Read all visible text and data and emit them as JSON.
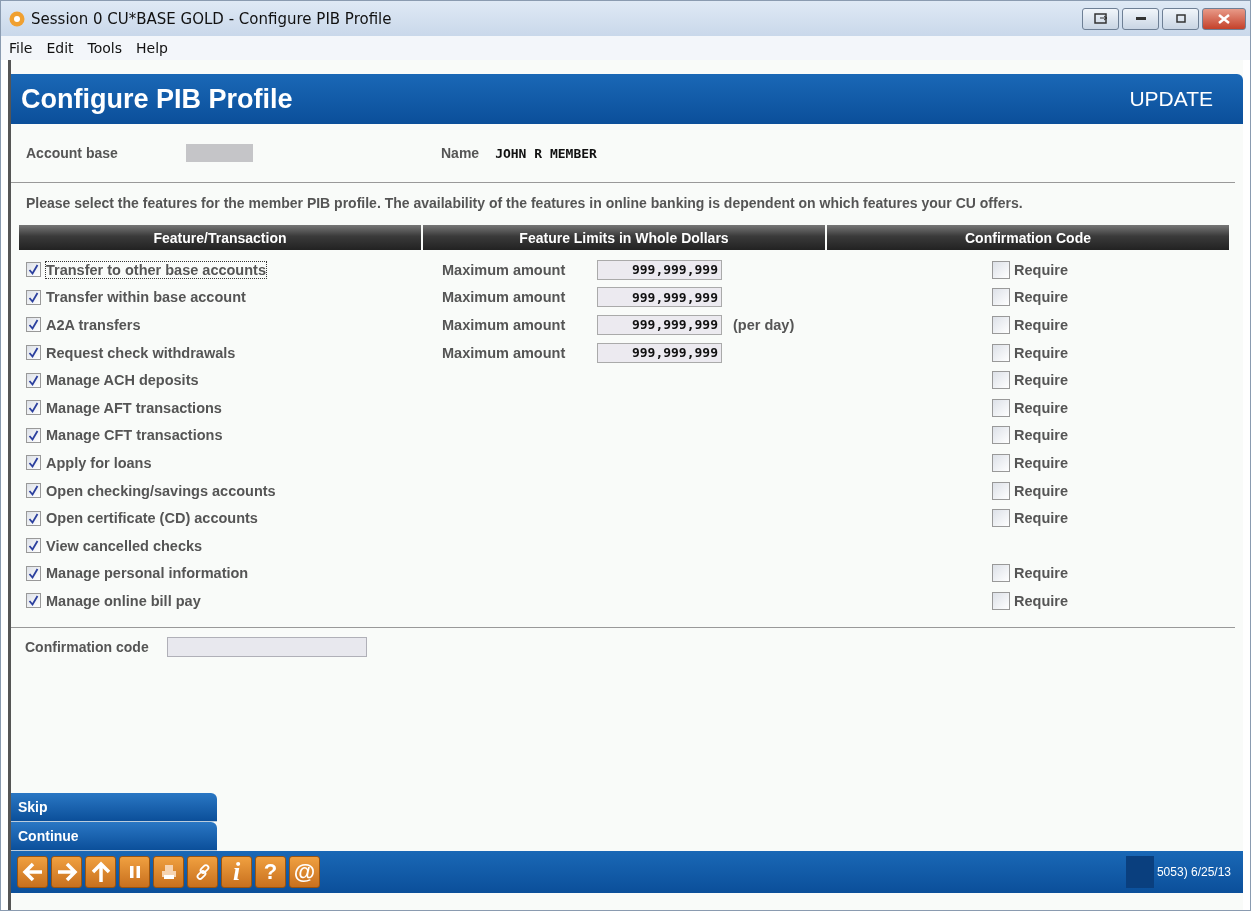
{
  "window": {
    "title": "Session 0 CU*BASE GOLD - Configure PIB Profile"
  },
  "menu": [
    "File",
    "Edit",
    "Tools",
    "Help"
  ],
  "header": {
    "title": "Configure PIB Profile",
    "mode": "UPDATE"
  },
  "account": {
    "label": "Account base",
    "name_label": "Name",
    "name": "JOHN R MEMBER"
  },
  "instructions": "Please select the features for the member PIB profile. The availability of the features in online banking is dependent on which features your CU offers.",
  "columns": [
    "Feature/Transaction",
    "Feature Limits in Whole Dollars",
    "Confirmation Code"
  ],
  "features": [
    {
      "label": "Transfer to other base accounts",
      "checked": true,
      "focused": true,
      "limit": {
        "label": "Maximum amount",
        "value": "999,999,999"
      },
      "confirm": {
        "label": "Require",
        "checked": false
      }
    },
    {
      "label": "Transfer within base account",
      "checked": true,
      "focused": false,
      "limit": {
        "label": "Maximum amount",
        "value": "999,999,999"
      },
      "confirm": {
        "label": "Require",
        "checked": false
      }
    },
    {
      "label": "A2A transfers",
      "checked": true,
      "focused": false,
      "limit": {
        "label": "Maximum amount",
        "value": "999,999,999",
        "note": "(per day)"
      },
      "confirm": {
        "label": "Require",
        "checked": false
      }
    },
    {
      "label": "Request check withdrawals",
      "checked": true,
      "focused": false,
      "limit": {
        "label": "Maximum amount",
        "value": "999,999,999"
      },
      "confirm": {
        "label": "Require",
        "checked": false
      }
    },
    {
      "label": "Manage ACH deposits",
      "checked": true,
      "focused": false,
      "confirm": {
        "label": "Require",
        "checked": false
      }
    },
    {
      "label": "Manage AFT transactions",
      "checked": true,
      "focused": false,
      "confirm": {
        "label": "Require",
        "checked": false
      }
    },
    {
      "label": "Manage CFT transactions",
      "checked": true,
      "focused": false,
      "confirm": {
        "label": "Require",
        "checked": false
      }
    },
    {
      "label": "Apply for loans",
      "checked": true,
      "focused": false,
      "confirm": {
        "label": "Require",
        "checked": false
      }
    },
    {
      "label": "Open checking/savings accounts",
      "checked": true,
      "focused": false,
      "confirm": {
        "label": "Require",
        "checked": false
      }
    },
    {
      "label": "Open certificate (CD) accounts",
      "checked": true,
      "focused": false,
      "confirm": {
        "label": "Require",
        "checked": false
      }
    },
    {
      "label": "View cancelled checks",
      "checked": true,
      "focused": false
    },
    {
      "label": "Manage personal information",
      "checked": true,
      "focused": false,
      "confirm": {
        "label": "Require",
        "checked": false
      }
    },
    {
      "label": "Manage online bill pay",
      "checked": true,
      "focused": false,
      "confirm": {
        "label": "Require",
        "checked": false
      }
    }
  ],
  "confirmation_code": {
    "label": "Confirmation code"
  },
  "actions": [
    "Skip",
    "Continue"
  ],
  "toolbar_glyphs": [
    "i",
    "?",
    "@"
  ],
  "status": "5053) 6/25/13"
}
